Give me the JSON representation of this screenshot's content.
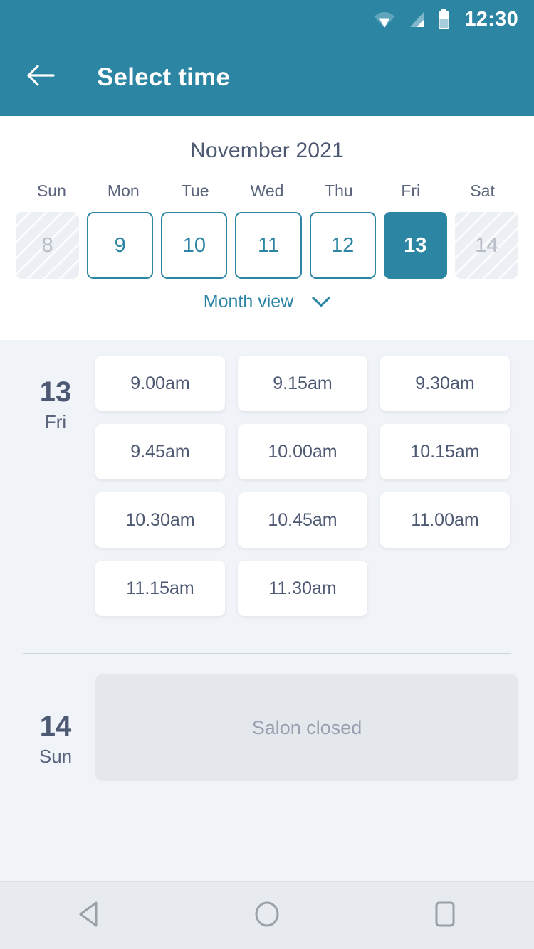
{
  "statusbar": {
    "time": "12:30",
    "icons": [
      "wifi-icon",
      "signal-icon",
      "battery-icon"
    ]
  },
  "appbar": {
    "back_icon": "arrow-left-icon",
    "title": "Select time"
  },
  "calendar": {
    "month_title": "November 2021",
    "weekdays": [
      "Sun",
      "Mon",
      "Tue",
      "Wed",
      "Thu",
      "Fri",
      "Sat"
    ],
    "days": [
      {
        "num": "8",
        "state": "disabled"
      },
      {
        "num": "9",
        "state": "available"
      },
      {
        "num": "10",
        "state": "available"
      },
      {
        "num": "11",
        "state": "available"
      },
      {
        "num": "12",
        "state": "available"
      },
      {
        "num": "13",
        "state": "selected"
      },
      {
        "num": "14",
        "state": "disabled"
      }
    ],
    "month_view_label": "Month view",
    "month_view_icon": "chevron-down-icon"
  },
  "schedule": [
    {
      "day_num": "13",
      "day_of_week": "Fri",
      "slots": [
        "9.00am",
        "9.15am",
        "9.30am",
        "9.45am",
        "10.00am",
        "10.15am",
        "10.30am",
        "10.45am",
        "11.00am",
        "11.15am",
        "11.30am"
      ],
      "closed_message": null
    },
    {
      "day_num": "14",
      "day_of_week": "Sun",
      "slots": [],
      "closed_message": "Salon closed"
    }
  ],
  "navbar": {
    "back_icon": "triangle-back-icon",
    "home_icon": "circle-home-icon",
    "recents_icon": "square-recents-icon"
  },
  "colors": {
    "accent": "#2b85a3",
    "page_bg": "#f0f3f7",
    "panel_bg": "#ffffff",
    "text_dark": "#4d5872",
    "text_muted": "#98a0b0",
    "disabled_bg": "#eceff4",
    "closed_bg": "#e4e8ed",
    "navbar_bg": "#e7eaee"
  }
}
